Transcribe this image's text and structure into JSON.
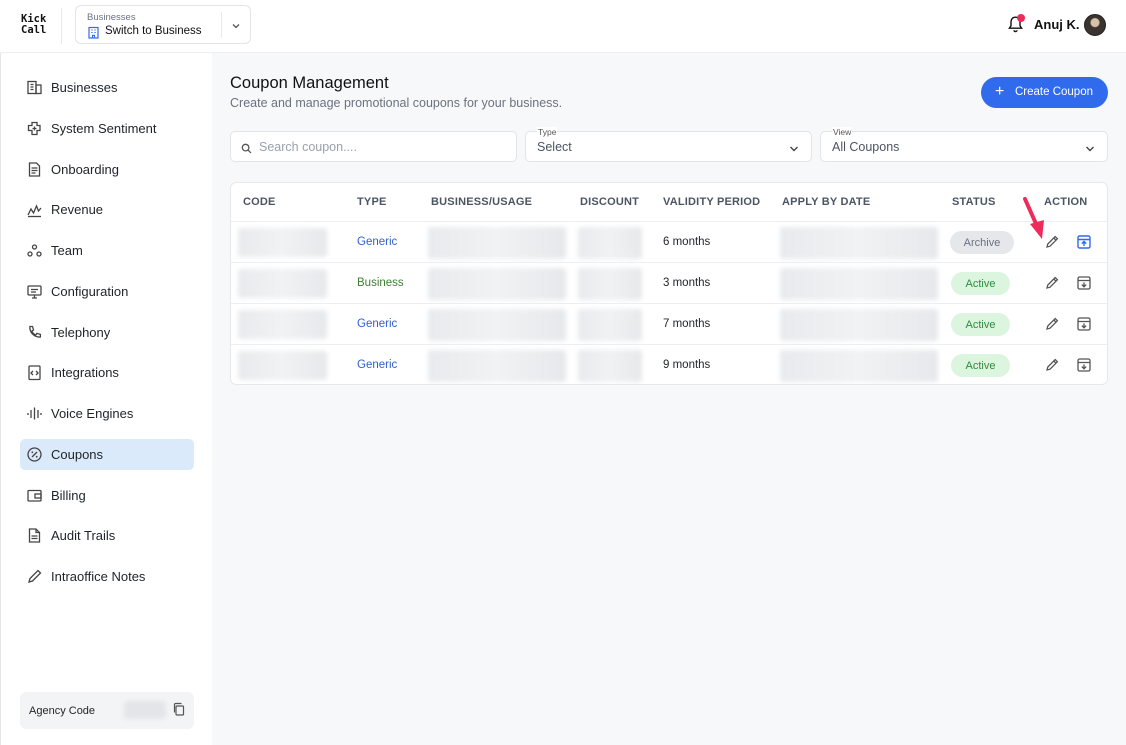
{
  "header": {
    "logo": [
      "Kick",
      "Call"
    ],
    "business_switch": {
      "label": "Businesses",
      "value": "Switch to Business"
    },
    "notification_count": "1",
    "user_name": "Anuj K."
  },
  "sidebar": {
    "items": [
      {
        "label": "Businesses",
        "icon": "building-icon",
        "active": false
      },
      {
        "label": "System Sentiment",
        "icon": "puzzle-icon",
        "active": false
      },
      {
        "label": "Onboarding",
        "icon": "document-icon",
        "active": false
      },
      {
        "label": "Revenue",
        "icon": "trend-icon",
        "active": false
      },
      {
        "label": "Team",
        "icon": "team-icon",
        "active": false
      },
      {
        "label": "Configuration",
        "icon": "monitor-icon",
        "active": false
      },
      {
        "label": "Telephony",
        "icon": "phone-icon",
        "active": false
      },
      {
        "label": "Integrations",
        "icon": "code-icon",
        "active": false
      },
      {
        "label": "Voice Engines",
        "icon": "waveform-icon",
        "active": false
      },
      {
        "label": "Coupons",
        "icon": "coupon-icon",
        "active": true
      },
      {
        "label": "Billing",
        "icon": "wallet-icon",
        "active": false
      },
      {
        "label": "Audit Trails",
        "icon": "file-icon",
        "active": false
      },
      {
        "label": "Intraoffice Notes",
        "icon": "pencil-icon",
        "active": false
      }
    ],
    "agency_code_label": "Agency Code"
  },
  "main": {
    "title": "Coupon Management",
    "subtitle": "Create and manage promotional coupons for your business.",
    "create_button": "Create Coupon",
    "search_placeholder": "Search coupon....",
    "type_filter": {
      "label": "Type",
      "value": "Select"
    },
    "view_filter": {
      "label": "View",
      "value": "All Coupons"
    }
  },
  "table": {
    "columns": [
      "CODE",
      "TYPE",
      "BUSINESS/USAGE",
      "DISCOUNT",
      "VALIDITY PERIOD",
      "APPLY BY DATE",
      "STATUS",
      "ACTION"
    ],
    "rows": [
      {
        "type": "Generic",
        "validity": "6 months",
        "status": "Archive"
      },
      {
        "type": "Business",
        "validity": "3 months",
        "status": "Active"
      },
      {
        "type": "Generic",
        "validity": "7 months",
        "status": "Active"
      },
      {
        "type": "Generic",
        "validity": "9 months",
        "status": "Active"
      }
    ]
  },
  "colors": {
    "accent": "#2f6bec",
    "active_nav_bg": "#dbeafb",
    "active_badge_bg": "#dcf5df",
    "archive_badge_bg": "#e5e7eb",
    "annotation_arrow": "#ef2b5a"
  }
}
